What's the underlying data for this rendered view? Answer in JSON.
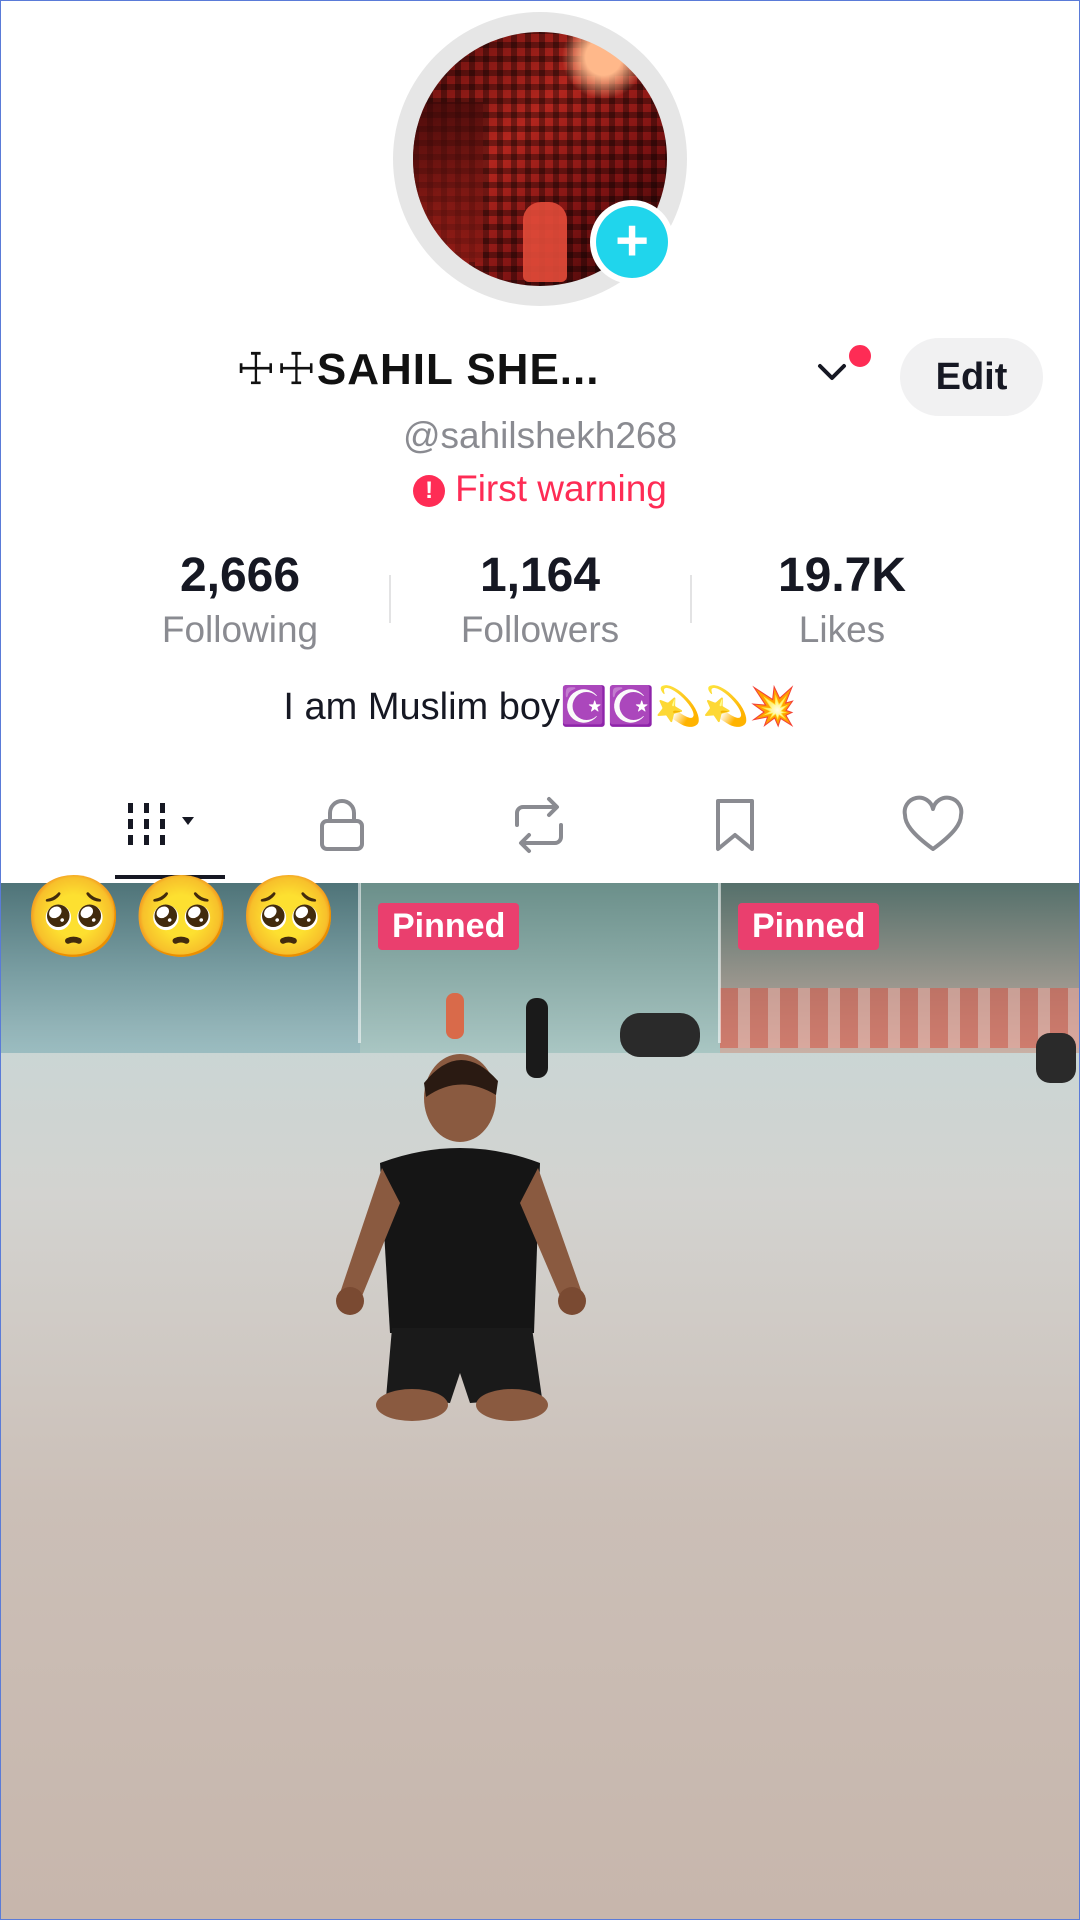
{
  "profile": {
    "display_name": "☩☩SAHIL SHE...",
    "handle": "@sahilshekh268",
    "warning": "First warning",
    "edit_label": "Edit",
    "bio": "I am Muslim boy☪️☪️💫💫💥"
  },
  "stats": [
    {
      "value": "2,666",
      "label": "Following"
    },
    {
      "value": "1,164",
      "label": "Followers"
    },
    {
      "value": "19.7K",
      "label": "Likes"
    }
  ],
  "tabs": [
    {
      "icon": "grid-icon"
    },
    {
      "icon": "lock-icon"
    },
    {
      "icon": "repost-icon"
    },
    {
      "icon": "bookmark-icon"
    },
    {
      "icon": "heart-icon"
    }
  ],
  "grid": {
    "pinned_labels": [
      "Pinned",
      "Pinned"
    ],
    "overlay_emojis": "🥺🥺🥺"
  },
  "colors": {
    "accent": "#fe2c55",
    "plus_badge": "#20d5ec",
    "pinned_badge": "#ea3f6e"
  }
}
